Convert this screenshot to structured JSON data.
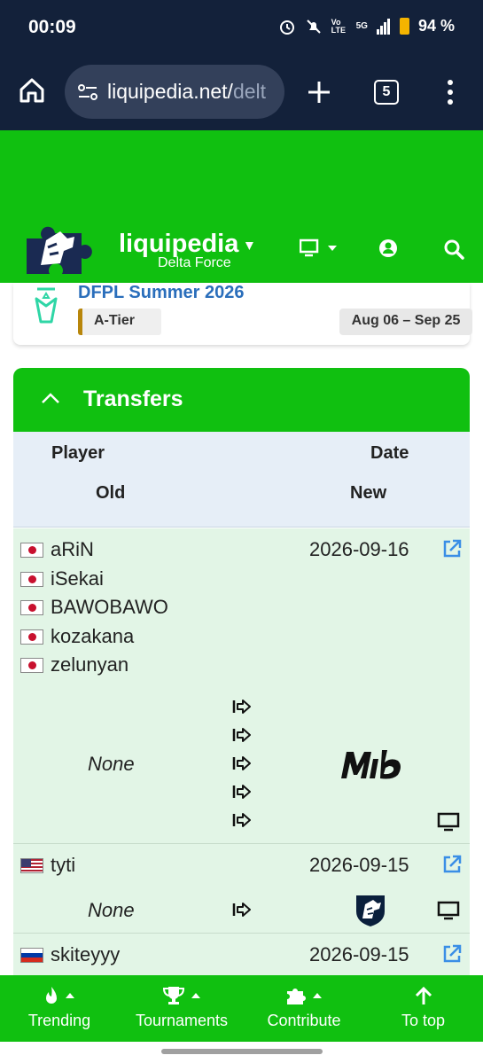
{
  "status_bar": {
    "time": "00:09",
    "network": "5G",
    "volte": "Vo LTE",
    "battery": "94 %"
  },
  "browser": {
    "url_main": "liquipedia.net/",
    "url_dim": "delt",
    "tab_count": "5"
  },
  "header": {
    "brand": "liquipedia",
    "caret": "▾",
    "subtitle": "Delta Force"
  },
  "tournament": {
    "name": "DFPL Summer 2026",
    "tier": "A-Tier",
    "dates": "Aug 06 – Sep 25"
  },
  "transfers": {
    "title": "Transfers",
    "headers": {
      "player": "Player",
      "date": "Date",
      "old": "Old",
      "new": "New"
    },
    "rows": [
      {
        "players": [
          {
            "flag": "jp",
            "name": "aRiN"
          },
          {
            "flag": "jp",
            "name": "iSekai"
          },
          {
            "flag": "jp",
            "name": "BAWOBAWO"
          },
          {
            "flag": "jp",
            "name": "kozakana"
          },
          {
            "flag": "jp",
            "name": "zelunyan"
          }
        ],
        "date": "2026-09-16",
        "old": "None",
        "new_team_icon": "mibr-logo-icon"
      },
      {
        "players": [
          {
            "flag": "us",
            "name": "tyti"
          }
        ],
        "date": "2026-09-15",
        "old": "None",
        "new_team_icon": "team-liquid-logo-icon"
      },
      {
        "players": [
          {
            "flag": "ru",
            "name": "skiteyyy"
          }
        ],
        "date": "2026-09-15"
      }
    ]
  },
  "bottom_nav": [
    {
      "label": "Trending",
      "icon": "fire-icon"
    },
    {
      "label": "Tournaments",
      "icon": "trophy-icon"
    },
    {
      "label": "Contribute",
      "icon": "puzzle-icon"
    },
    {
      "label": "To top",
      "icon": "arrow-up-icon"
    }
  ],
  "colors": {
    "green": "#10c010",
    "dark_bar": "#13213a",
    "link_blue": "#2a6ebb",
    "row_bg": "#e2f5e6"
  }
}
